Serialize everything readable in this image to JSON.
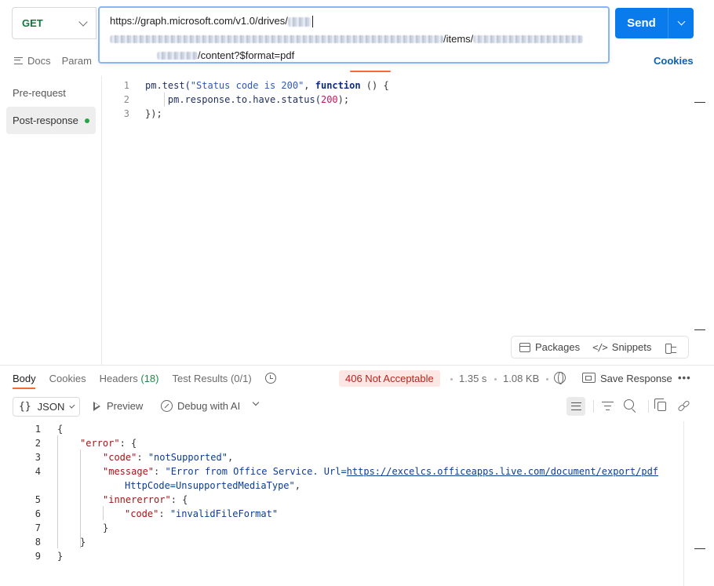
{
  "request": {
    "method": "GET",
    "url_line1": "https://graph.microsoft.com/v1.0/drives/",
    "url_line2_segment": "/items/",
    "url_line3_suffix": "/content?$format=pdf",
    "send_label": "Send"
  },
  "request_tabs": {
    "docs": "Docs",
    "params": "Param",
    "cookies": "Cookies"
  },
  "scripts": {
    "pre_request": "Pre-request",
    "post_response": "Post-response",
    "code": {
      "l1_obj": "pm.test(",
      "l1_str": "\"Status code is 200\"",
      "l1_sep": ", ",
      "l1_kw": "function",
      "l1_tail": " () {",
      "l2_obj": "pm.response.to.have.status(",
      "l2_num": "200",
      "l2_tail": ");",
      "l3": "});",
      "line_numbers": [
        "1",
        "2",
        "3"
      ]
    },
    "tools": {
      "packages": "Packages",
      "snippets": "Snippets"
    }
  },
  "response": {
    "tabs": {
      "body": "Body",
      "cookies": "Cookies",
      "headers": "Headers",
      "headers_count": "(18)",
      "test_results": "Test Results",
      "test_results_count": "(0/1)"
    },
    "status": "406 Not Acceptable",
    "time": "1.35 s",
    "size": "1.08 KB",
    "save_response": "Save Response",
    "more": "•••",
    "format": "JSON",
    "format_braces": "{}",
    "preview": "Preview",
    "debug_with_ai": "Debug with AI",
    "body": {
      "line_numbers": [
        "1",
        "2",
        "3",
        "4",
        "",
        "5",
        "6",
        "7",
        "8",
        "9"
      ],
      "open_brace": "{",
      "error_key": "\"error\"",
      "colon_open": ": {",
      "code_key": "\"code\"",
      "code_val": "\"notSupported\"",
      "message_key": "\"message\"",
      "message_prefix": "\"Error from Office Service. Url=",
      "message_url": "https://excelcs.officeapps.live.com/document/export/pdf",
      "message_suffix": "HttpCode=UnsupportedMediaType\"",
      "innererror_key": "\"innererror\"",
      "inner_code_key": "\"code\"",
      "inner_code_val": "\"invalidFileFormat\"",
      "close_inner": "}",
      "close_error": "}",
      "close_root": "}"
    }
  },
  "colors": {
    "send_button": "#097bed",
    "method_get": "#0b7a3e",
    "status_error_bg": "#fde7e4",
    "status_error_text": "#b3261e",
    "active_tab_accent": "#f26b3a"
  }
}
